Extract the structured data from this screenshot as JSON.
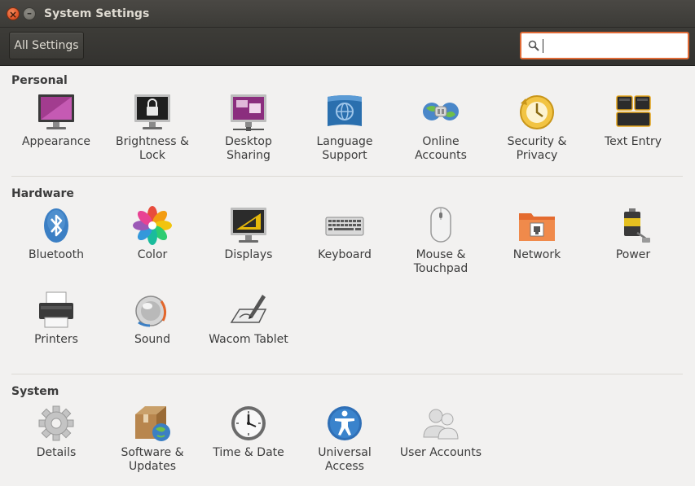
{
  "window": {
    "title": "System Settings"
  },
  "toolbar": {
    "all_settings_label": "All Settings",
    "search_value": ""
  },
  "sections": {
    "personal": {
      "title": "Personal",
      "items": [
        {
          "label": "Appearance",
          "icon": "appearance-icon"
        },
        {
          "label": "Brightness &\nLock",
          "icon": "brightness-lock-icon"
        },
        {
          "label": "Desktop\nSharing",
          "icon": "desktop-sharing-icon"
        },
        {
          "label": "Language\nSupport",
          "icon": "language-support-icon"
        },
        {
          "label": "Online\nAccounts",
          "icon": "online-accounts-icon"
        },
        {
          "label": "Security &\nPrivacy",
          "icon": "security-privacy-icon"
        },
        {
          "label": "Text Entry",
          "icon": "text-entry-icon"
        }
      ]
    },
    "hardware": {
      "title": "Hardware",
      "items": [
        {
          "label": "Bluetooth",
          "icon": "bluetooth-icon"
        },
        {
          "label": "Color",
          "icon": "color-icon"
        },
        {
          "label": "Displays",
          "icon": "displays-icon"
        },
        {
          "label": "Keyboard",
          "icon": "keyboard-icon"
        },
        {
          "label": "Mouse &\nTouchpad",
          "icon": "mouse-touchpad-icon"
        },
        {
          "label": "Network",
          "icon": "network-icon"
        },
        {
          "label": "Power",
          "icon": "power-icon"
        },
        {
          "label": "Printers",
          "icon": "printers-icon"
        },
        {
          "label": "Sound",
          "icon": "sound-icon"
        },
        {
          "label": "Wacom Tablet",
          "icon": "wacom-tablet-icon"
        }
      ]
    },
    "system": {
      "title": "System",
      "items": [
        {
          "label": "Details",
          "icon": "details-icon"
        },
        {
          "label": "Software &\nUpdates",
          "icon": "software-updates-icon"
        },
        {
          "label": "Time & Date",
          "icon": "time-date-icon"
        },
        {
          "label": "Universal\nAccess",
          "icon": "universal-access-icon"
        },
        {
          "label": "User Accounts",
          "icon": "user-accounts-icon"
        }
      ]
    }
  },
  "colors": {
    "accent": "#e06a36",
    "titlebar": "#3c3b37",
    "background": "#f2f1f0"
  }
}
